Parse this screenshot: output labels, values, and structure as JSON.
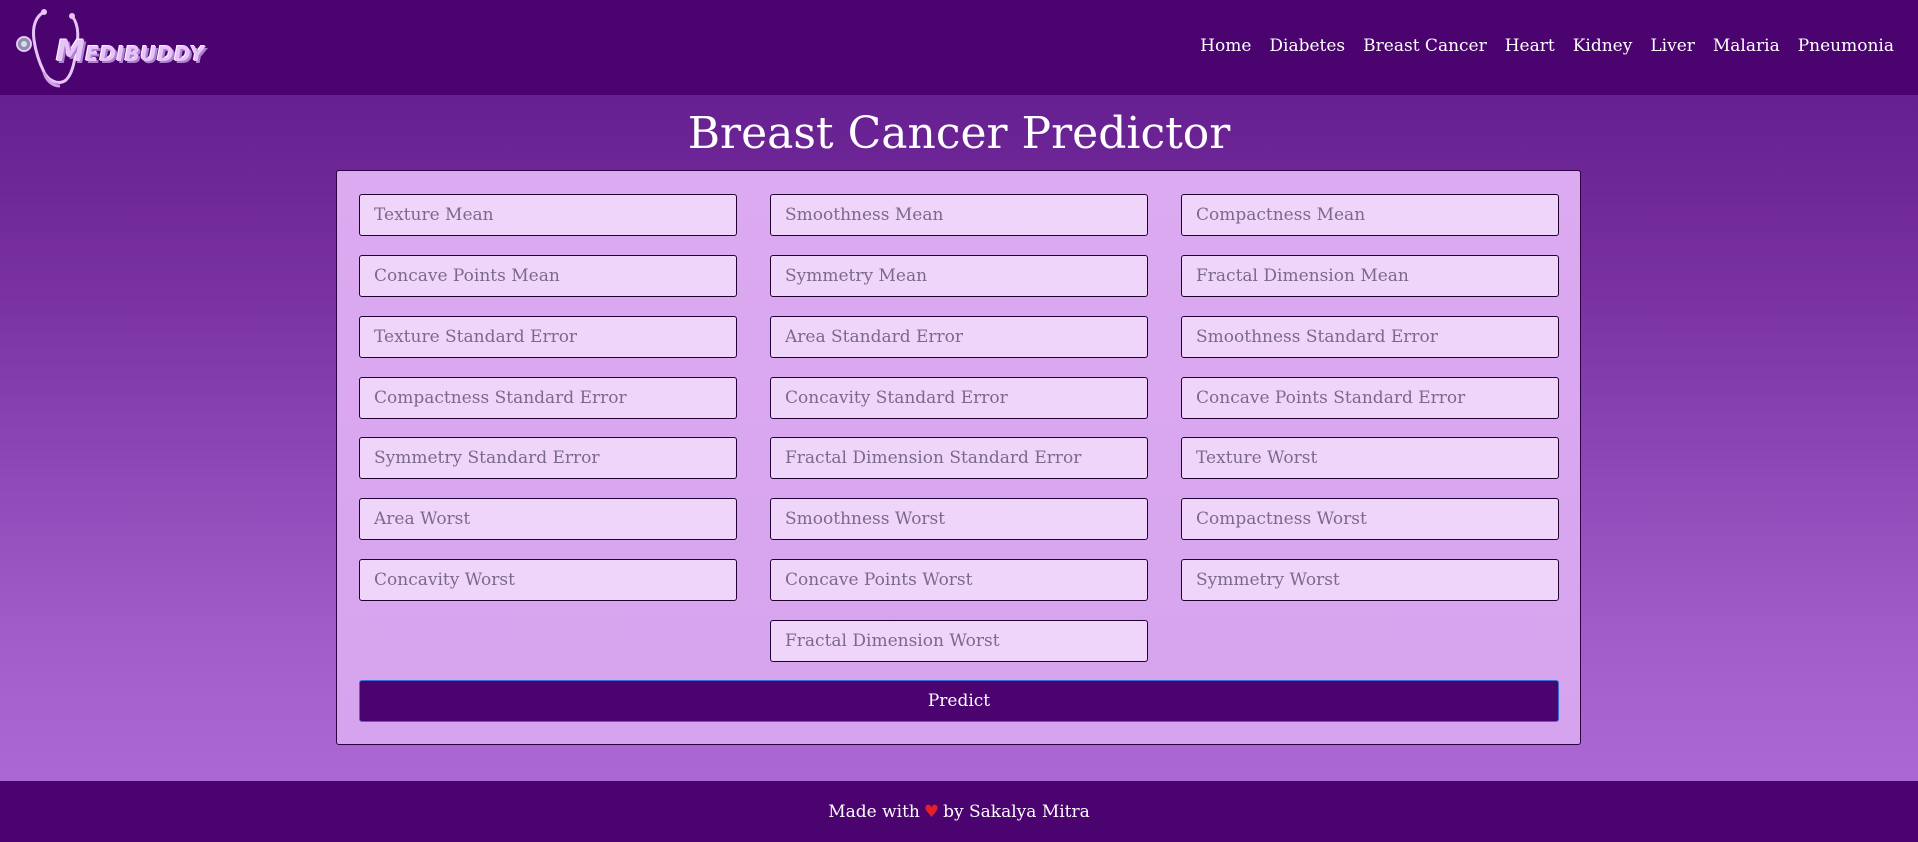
{
  "brand": {
    "name": "Medibuddy",
    "logo_icon": "stethoscope-icon"
  },
  "nav": {
    "links": [
      "Home",
      "Diabetes",
      "Breast Cancer",
      "Heart",
      "Kidney",
      "Liver",
      "Malaria",
      "Pneumonia"
    ]
  },
  "page": {
    "title": "Breast Cancer Predictor"
  },
  "form": {
    "fields": [
      "Texture Mean",
      "Smoothness Mean",
      "Compactness Mean",
      "Concave Points Mean",
      "Symmetry Mean",
      "Fractal Dimension Mean",
      "Texture Standard Error",
      "Area Standard Error",
      "Smoothness Standard Error",
      "Compactness Standard Error",
      "Concavity Standard Error",
      "Concave Points Standard Error",
      "Symmetry Standard Error",
      "Fractal Dimension Standard Error",
      "Texture Worst",
      "Area Worst",
      "Smoothness Worst",
      "Compactness Worst",
      "Concavity Worst",
      "Concave Points Worst",
      "Symmetry Worst",
      "Fractal Dimension Worst"
    ],
    "submit_label": "Predict"
  },
  "footer": {
    "prefix": "Made with",
    "heart_icon": "heart-icon",
    "suffix": "by Sakalya Mitra"
  },
  "colors": {
    "nav_bg": "#4a036f",
    "card_bg": "#dcaaf1",
    "field_bg": "#f0d5fb",
    "heart": "#e0202a"
  }
}
